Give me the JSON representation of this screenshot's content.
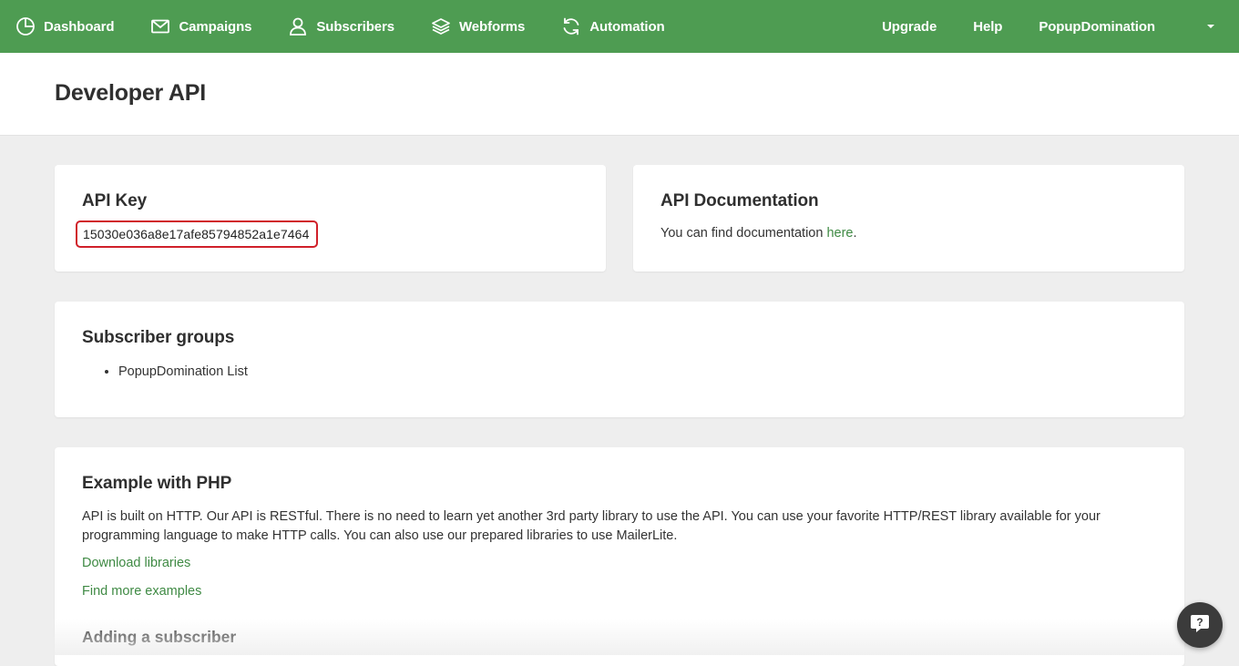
{
  "colors": {
    "nav_background": "#4e9c52",
    "page_background": "#eeeeee",
    "link": "#3f8a44",
    "api_key_highlight": "#d0202a"
  },
  "nav": {
    "items": [
      {
        "label": "Dashboard",
        "icon": "dashboard-icon"
      },
      {
        "label": "Campaigns",
        "icon": "envelope-icon"
      },
      {
        "label": "Subscribers",
        "icon": "user-icon"
      },
      {
        "label": "Webforms",
        "icon": "layers-icon"
      },
      {
        "label": "Automation",
        "icon": "refresh-icon"
      }
    ],
    "upgrade": "Upgrade",
    "help": "Help",
    "account": "PopupDomination",
    "account_menu_icon": "caret-down-icon"
  },
  "page": {
    "title": "Developer API"
  },
  "api_key": {
    "heading": "API Key",
    "value": "15030e036a8e17afe85794852a1e7464"
  },
  "documentation": {
    "heading": "API Documentation",
    "text_before": "You can find documentation ",
    "link": "here",
    "text_after": "."
  },
  "groups": {
    "heading": "Subscriber groups",
    "items": [
      "PopupDomination List"
    ]
  },
  "php": {
    "heading": "Example with PHP",
    "description": "API is built on HTTP. Our API is RESTful. There is no need to learn yet another 3rd party library to use the API. You can use your favorite HTTP/REST library available for your programming language to make HTTP calls. You can also use our prepared libraries to use MailerLite.",
    "download_link": "Download libraries",
    "examples_link": "Find more examples",
    "subheading": "Adding a subscriber"
  },
  "help_widget": {
    "icon": "chat-help-icon"
  }
}
